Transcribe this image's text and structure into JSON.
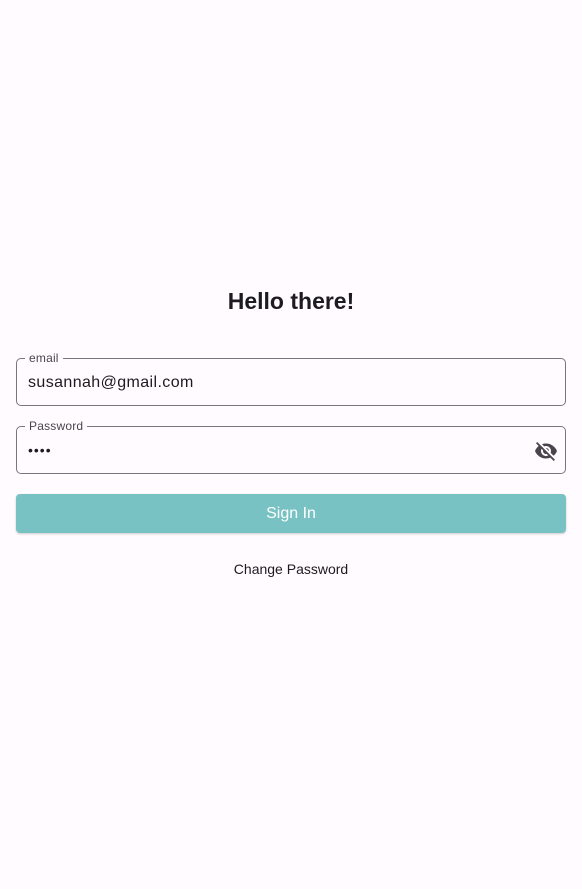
{
  "page": {
    "title": "Hello there!"
  },
  "form": {
    "email": {
      "label": "email",
      "value": "susannah@gmail.com"
    },
    "password": {
      "label": "Password",
      "masked_value": "••••",
      "visibility_icon": "visibility-off-icon"
    },
    "signin_label": "Sign In",
    "change_password_label": "Change Password"
  },
  "colors": {
    "background": "#fffbfe",
    "primary_button": "#78c2c4",
    "outline": "#79747e",
    "text": "#1c1b1f"
  }
}
